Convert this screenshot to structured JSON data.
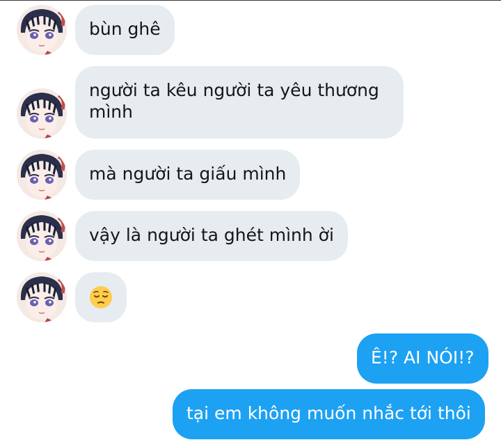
{
  "messages": [
    {
      "side": "in",
      "text": "bùn ghê"
    },
    {
      "side": "in",
      "text": "người ta kêu người ta yêu thương",
      "text2": "mình"
    },
    {
      "side": "in",
      "text": "mà người ta giấu mình"
    },
    {
      "side": "in",
      "text": "vậy là người ta ghét mình ời"
    },
    {
      "side": "in",
      "emoji": "pensive-face"
    },
    {
      "side": "out",
      "text": "Ê!? AI NÓI!?"
    },
    {
      "side": "out",
      "text": "tại em không muốn nhắc tới thôi"
    }
  ],
  "colors": {
    "incoming_bubble": "#e6ecf0",
    "outgoing_bubble": "#1da1f2",
    "incoming_text": "#14171a",
    "outgoing_text": "#ffffff"
  }
}
